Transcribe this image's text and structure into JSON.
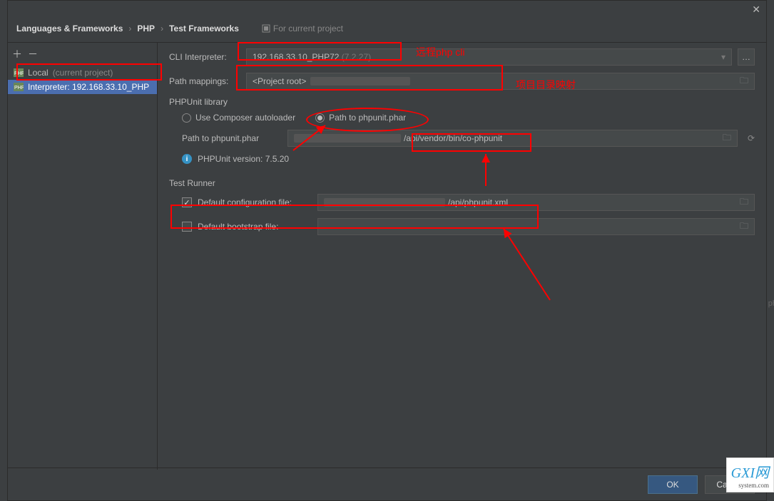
{
  "titlebar": {
    "close": "✕"
  },
  "breadcrumb": {
    "levels": [
      "Languages & Frameworks",
      "PHP",
      "Test Frameworks"
    ],
    "hint": "For current project"
  },
  "sidebar": {
    "add": "＋",
    "remove": "－",
    "items": [
      {
        "label": "Local",
        "suffix": " (current project)",
        "selected": false
      },
      {
        "label": "Interpreter: 192.168.33.10_PHP",
        "suffix": "",
        "selected": true
      }
    ]
  },
  "cli": {
    "label": "CLI Interpreter:",
    "value": "192.168.33.10_PHP72",
    "version": "(7.2.27)",
    "more": "…"
  },
  "mapping": {
    "label": "Path mappings:",
    "value": "<Project root>"
  },
  "lib": {
    "title": "PHPUnit library",
    "opt_composer": "Use Composer autoloader",
    "opt_phar": "Path to phpunit.phar",
    "path_label": "Path to phpunit.phar",
    "path_value": "/api/vendor/bin/co-phpunit",
    "version_label": "PHPUnit version: 7.5.20"
  },
  "runner": {
    "title": "Test Runner",
    "conf_label": "Default configuration file:",
    "conf_value": "/api/phpunit.xml",
    "boot_label": "Default bootstrap file:"
  },
  "footer": {
    "ok": "OK",
    "cancel": "Cancel"
  },
  "annotations": {
    "cli_note": "远程php cli",
    "map_note": "项目目录映射"
  },
  "watermark": {
    "name": "GXI网",
    "sub": "system.com"
  },
  "side_clip": "ph"
}
